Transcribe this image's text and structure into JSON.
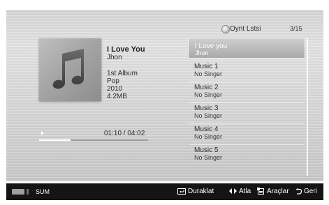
{
  "now_playing": {
    "title": "I Love You",
    "artist": "Jhon",
    "album": "1st Album",
    "genre": "Pop",
    "year": "2010",
    "size": "4.2MB",
    "time": "01:10 / 04:02",
    "progress": 0.29
  },
  "playlist": {
    "label": "Oynt Lstsi",
    "count": "3/15",
    "items": [
      {
        "title": "I Love you",
        "artist": "Jhon"
      },
      {
        "title": "Music 1",
        "artist": "No Singer"
      },
      {
        "title": "Music 2",
        "artist": "No Singer"
      },
      {
        "title": "Music 3",
        "artist": "No Singer"
      },
      {
        "title": "Music 4",
        "artist": "No Singer"
      },
      {
        "title": "Music 5",
        "artist": "No Singer"
      }
    ]
  },
  "bottom_bar": {
    "sum_label": "SUM",
    "controls": {
      "pause": "Duraklat",
      "skip": "Atla",
      "tools": "Araçlar",
      "back": "Geri"
    }
  },
  "icons": {
    "playlist": "disc-icon",
    "pause": "enter-icon",
    "skip": "left-right-arrows-icon",
    "tools": "tools-icon",
    "back": "return-icon"
  }
}
